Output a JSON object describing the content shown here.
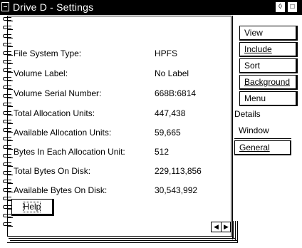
{
  "window": {
    "title": "Drive D - Settings",
    "restore_glyph": "◊",
    "maximize_glyph": "□"
  },
  "properties": [
    {
      "label": "File System Type:",
      "value": "HPFS"
    },
    {
      "label": "Volume Label:",
      "value": "No Label"
    },
    {
      "label": "Volume Serial Number:",
      "value": "668B:6814"
    },
    {
      "label": "Total Allocation Units:",
      "value": "447,438"
    },
    {
      "label": "Available Allocation Units:",
      "value": "59,665"
    },
    {
      "label": "Bytes In Each Allocation Unit:",
      "value": "512"
    },
    {
      "label": "Total Bytes On Disk:",
      "value": "229,113,856"
    },
    {
      "label": "Available Bytes On Disk:",
      "value": "30,543,992"
    }
  ],
  "help_button": "Help",
  "page_arrows": {
    "prev": "◀",
    "next": "▶"
  },
  "tabs": [
    "View",
    "Include",
    "Sort",
    "Background",
    "Menu",
    "Details",
    "Window",
    "General"
  ],
  "active_tab": "Details",
  "icons": [
    "system-menu-icon",
    "restore-icon",
    "maximize-icon",
    "spiral-binding-icon",
    "prev-page-arrow-icon",
    "next-page-arrow-icon"
  ]
}
